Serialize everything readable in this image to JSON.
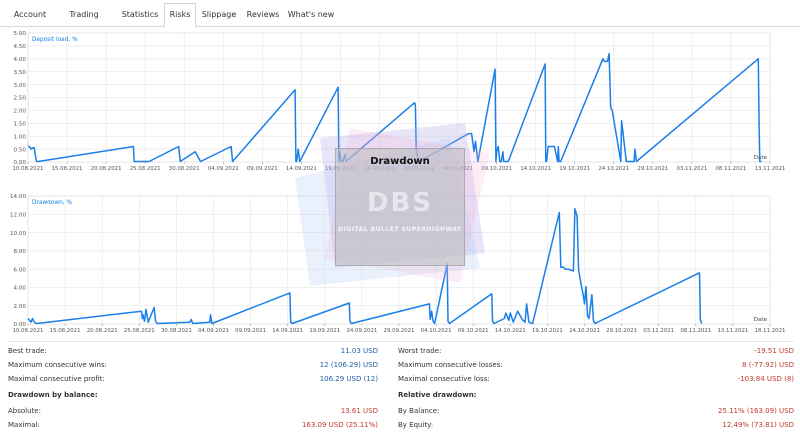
{
  "tabs": [
    {
      "label": "Account",
      "active": false
    },
    {
      "label": "Trading history",
      "active": false
    },
    {
      "label": "Statistics",
      "active": false
    },
    {
      "label": "Risks",
      "active": true
    },
    {
      "label": "Slippage",
      "active": false
    },
    {
      "label": "Reviews",
      "active": false
    },
    {
      "label": "What's new",
      "active": false
    }
  ],
  "colors": {
    "line": "#1a7fe8",
    "grid": "#e6e6e6",
    "axis": "#999999",
    "blue_value": "#1f5fa8",
    "red_value": "#c0392b"
  },
  "watermark": {
    "title": "Drawdown",
    "logo": "DBS",
    "text": "DIGITAL BULLET SUPERHIGHWAY"
  },
  "chart_data": [
    {
      "type": "line",
      "legend": "Deposit load, %",
      "xlabel": "Date",
      "ylim": [
        0,
        5
      ],
      "yticks": [
        "0.00",
        "0.50",
        "1.00",
        "1.50",
        "2.00",
        "2.50",
        "3.00",
        "3.50",
        "4.00",
        "4.50",
        "5.00"
      ],
      "xticks": [
        "10.08.2021",
        "15.08.2021",
        "20.08.2021",
        "25.08.2021",
        "30.08.2021",
        "04.09.2021",
        "09.09.2021",
        "14.09.2021",
        "19.09.2021",
        "24.09.2021",
        "29.09.2021",
        "04.10.2021",
        "09.10.2021",
        "14.10.2021",
        "19.10.2021",
        "24.10.2021",
        "29.10.2021",
        "03.11.2021",
        "08.11.2021",
        "13.11.2021"
      ],
      "xlim_days": [
        0,
        95
      ],
      "x": [
        0,
        0.2,
        0.4,
        0.6,
        0.8,
        1,
        1.1,
        1.3,
        13.5,
        13.6,
        15,
        15.5,
        19.3,
        19.5,
        21.4,
        22.1,
        26,
        26.2,
        34.2,
        34.3,
        34.4,
        34.6,
        34.8,
        39.7,
        39.8,
        39.9,
        40.1,
        40.3,
        40.6,
        40.7,
        49.5,
        49.6,
        49.7,
        49.8,
        50,
        50.1,
        56.4,
        56.6,
        56.8,
        57.1,
        57.3,
        57.6,
        59.8,
        59.9,
        60,
        60.2,
        60.4,
        60.6,
        60.8,
        60.9,
        61.5,
        66.2,
        66.3,
        66.4,
        66.6,
        67.2,
        67.4,
        67.8,
        67.9,
        68,
        68.2,
        73.6,
        73.8,
        74,
        74.2,
        74.4,
        74.6,
        74.8,
        75.9,
        76,
        76.6,
        76.8,
        77.1,
        77.3,
        77.6,
        77.7,
        77.9,
        93.5,
        93.6,
        93.7,
        93.9
      ],
      "y": [
        0.6,
        0.6,
        0.5,
        0.55,
        0.55,
        0.15,
        0.02,
        0.02,
        0.6,
        0.02,
        0.02,
        0.02,
        0.6,
        0.02,
        0.4,
        0.02,
        0.6,
        0.02,
        2.8,
        0.02,
        0.02,
        0.5,
        0.02,
        2.9,
        0.02,
        0.4,
        0.02,
        0.02,
        0.3,
        0.02,
        2.3,
        2.2,
        0.5,
        0.3,
        0.02,
        0.02,
        1.1,
        1.1,
        1.1,
        0.4,
        0.8,
        0.02,
        3.6,
        0.02,
        0.4,
        0.6,
        0.02,
        0.02,
        0.4,
        0.02,
        0.02,
        3.8,
        0.02,
        0.02,
        0.6,
        0.6,
        0.6,
        0.02,
        0.6,
        0.02,
        0.02,
        4.0,
        3.9,
        3.9,
        3.9,
        4.2,
        2.1,
        2.0,
        0.02,
        1.6,
        0.02,
        0.02,
        0.02,
        0.02,
        0.02,
        0.5,
        0.02,
        4.0,
        1.4,
        0.02,
        0.02
      ]
    },
    {
      "type": "line",
      "legend": "Drawdown, %",
      "xlabel": "Date",
      "ylim": [
        0,
        14
      ],
      "yticks": [
        "0.00",
        "2.00",
        "4.00",
        "6.00",
        "8.00",
        "10.00",
        "12.00",
        "14.00"
      ],
      "xticks": [
        "10.08.2021",
        "15.08.2021",
        "20.08.2021",
        "25.08.2021",
        "30.08.2021",
        "04.09.2021",
        "09.09.2021",
        "14.09.2021",
        "19.09.2021",
        "24.09.2021",
        "29.09.2021",
        "04.10.2021",
        "09.10.2021",
        "14.10.2021",
        "19.10.2021",
        "24.10.2021",
        "29.10.2021",
        "03.11.2021",
        "08.11.2021",
        "13.11.2021",
        "18.11.2021"
      ],
      "xlim_days": [
        0,
        100
      ],
      "x": [
        0,
        0.2,
        0.4,
        0.6,
        0.8,
        1,
        1.2,
        15.3,
        15.4,
        15.5,
        15.7,
        15.9,
        16.2,
        17,
        17.2,
        17.4,
        21.8,
        22,
        22.2,
        24.5,
        24.6,
        24.8,
        35.3,
        35.4,
        35.6,
        43.3,
        43.4,
        43.6,
        54.1,
        54.2,
        54.4,
        54.6,
        54.8,
        56.5,
        56.6,
        56.8,
        62.5,
        62.6,
        62.8,
        64.2,
        64.4,
        64.8,
        65,
        65.4,
        66,
        66.6,
        67,
        67.2,
        67.5,
        68,
        71.6,
        71.8,
        72,
        72.2,
        72.4,
        72.6,
        72.8,
        73.5,
        73.7,
        74,
        74.2,
        74.6,
        74.8,
        75,
        75.2,
        75.4,
        75.6,
        76,
        76.2,
        76.4,
        90.5,
        90.6,
        90.8
      ],
      "y": [
        0.6,
        0.4,
        0.2,
        0.6,
        0.3,
        0.1,
        0.05,
        1.4,
        0.6,
        1.0,
        0.3,
        1.6,
        0.2,
        1.8,
        0.3,
        0.05,
        0.2,
        0.5,
        0.05,
        0.2,
        1.0,
        0.05,
        3.4,
        0.2,
        0.05,
        2.3,
        0.3,
        0.05,
        2.2,
        0.5,
        1.4,
        0.3,
        0.05,
        6.6,
        0.3,
        0.05,
        3.3,
        0.3,
        0.05,
        0.6,
        1.2,
        0.4,
        1.2,
        0.2,
        1.4,
        0.5,
        0.2,
        2.2,
        0.2,
        0.05,
        12.2,
        6.2,
        6.2,
        6.2,
        6.0,
        6.0,
        6.0,
        5.8,
        12.6,
        11.8,
        5.9,
        4.1,
        3.3,
        2.2,
        4.1,
        0.9,
        0.6,
        3.2,
        0.4,
        0.05,
        5.6,
        0.5,
        0.05
      ]
    }
  ],
  "stats": {
    "left": [
      {
        "label": "Best trade:",
        "value": "11.03 USD",
        "color": "blue"
      },
      {
        "label": "Maximum consecutive wins:",
        "value": "12 (106.29) USD",
        "color": "blue"
      },
      {
        "label": "Maximal consecutive profit:",
        "value": "106.29 USD (12)",
        "color": "blue"
      },
      {
        "label": "Drawdown by balance:",
        "value": "",
        "section": true
      },
      {
        "label": "Absolute:",
        "value": "13.61 USD",
        "color": "red"
      },
      {
        "label": "Maximal:",
        "value": "163.09 USD (25.11%)",
        "color": "red"
      }
    ],
    "right": [
      {
        "label": "Worst trade:",
        "value": "-19.51 USD",
        "color": "red"
      },
      {
        "label": "Maximum consecutive losses:",
        "value": "8 (-77.92) USD",
        "color": "red"
      },
      {
        "label": "Maximal consecutive loss:",
        "value": "-103.84 USD (8)",
        "color": "red"
      },
      {
        "label": "Relative drawdown:",
        "value": "",
        "section": true
      },
      {
        "label": "By Balance:",
        "value": "25.11% (163.09) USD",
        "color": "red"
      },
      {
        "label": "By Equity:",
        "value": "12.49% (73.81) USD",
        "color": "red"
      }
    ]
  }
}
